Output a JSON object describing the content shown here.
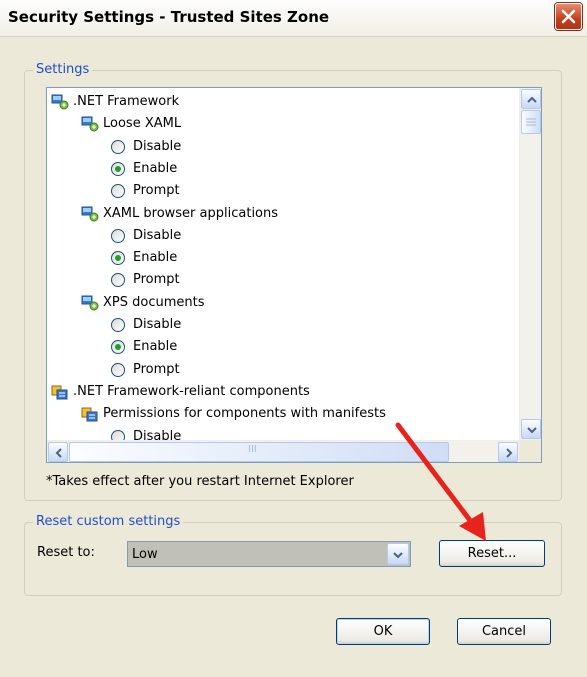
{
  "window": {
    "title": "Security Settings - Trusted Sites Zone"
  },
  "settings_group": {
    "title": "Settings",
    "tree": [
      {
        "type": "category",
        "label": ".NET Framework",
        "icon": "settings-icon"
      },
      {
        "type": "category",
        "label": "Loose XAML",
        "icon": "settings-icon"
      },
      {
        "type": "option",
        "label": "Disable",
        "checked": false
      },
      {
        "type": "option",
        "label": "Enable",
        "checked": true
      },
      {
        "type": "option",
        "label": "Prompt",
        "checked": false
      },
      {
        "type": "category",
        "label": "XAML browser applications",
        "icon": "settings-icon"
      },
      {
        "type": "option",
        "label": "Disable",
        "checked": false
      },
      {
        "type": "option",
        "label": "Enable",
        "checked": true
      },
      {
        "type": "option",
        "label": "Prompt",
        "checked": false
      },
      {
        "type": "category",
        "label": "XPS documents",
        "icon": "settings-icon"
      },
      {
        "type": "option",
        "label": "Disable",
        "checked": false
      },
      {
        "type": "option",
        "label": "Enable",
        "checked": true
      },
      {
        "type": "option",
        "label": "Prompt",
        "checked": false
      },
      {
        "type": "category",
        "label": ".NET Framework-reliant components",
        "icon": "components-icon"
      },
      {
        "type": "category",
        "label": "Permissions for components with manifests",
        "icon": "components-icon"
      },
      {
        "type": "option",
        "label": "Disable",
        "checked": false
      }
    ],
    "hscroll_grip": "III",
    "note": "*Takes effect after you restart Internet Explorer"
  },
  "reset_group": {
    "title": "Reset custom settings",
    "reset_to_label": "Reset to:",
    "reset_to_value": "Low",
    "reset_button": "Reset..."
  },
  "buttons": {
    "ok": "OK",
    "cancel": "Cancel"
  },
  "colors": {
    "group_title": "#1f4fc8",
    "annotation_arrow": "#e8231c",
    "enabled_radio": "#21a121"
  }
}
